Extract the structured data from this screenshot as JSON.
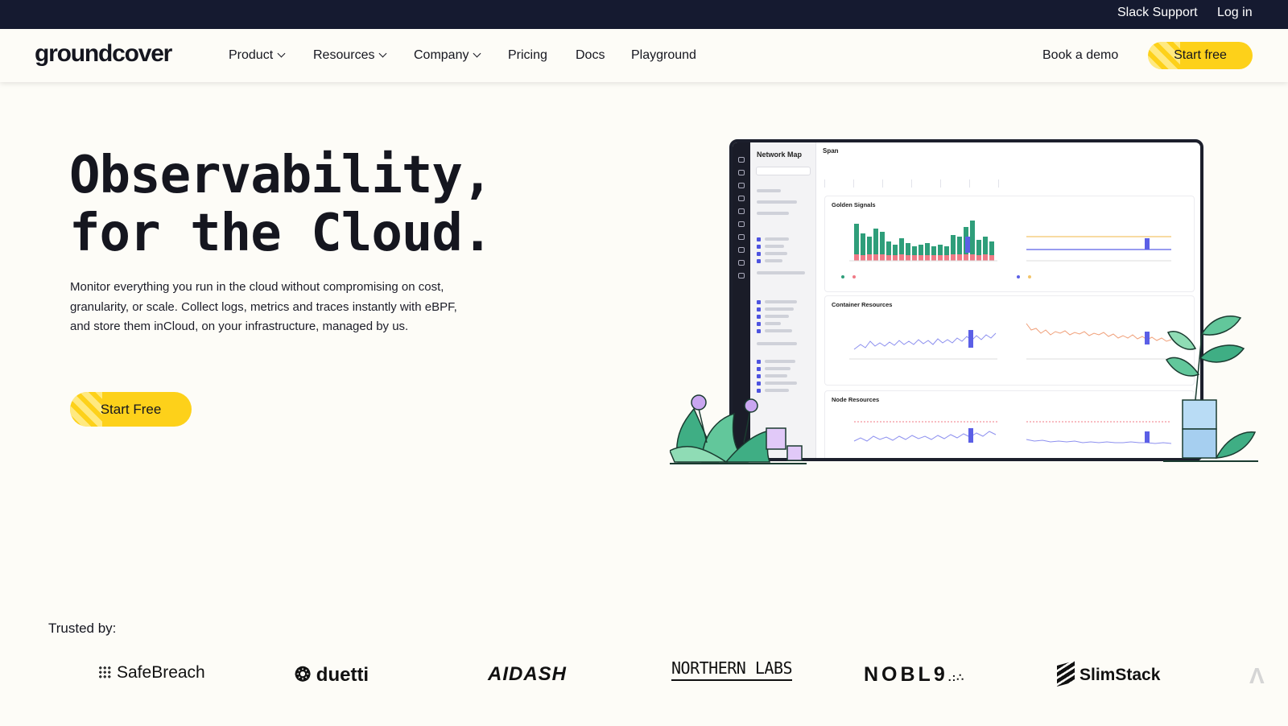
{
  "topbar": {
    "slack_support": "Slack Support",
    "log_in": "Log in"
  },
  "brand": {
    "logo_text": "groundcover"
  },
  "nav": {
    "items": [
      {
        "label": "Product",
        "has_dropdown": true
      },
      {
        "label": "Resources",
        "has_dropdown": true
      },
      {
        "label": "Company",
        "has_dropdown": true
      },
      {
        "label": "Pricing",
        "has_dropdown": false
      },
      {
        "label": "Docs",
        "has_dropdown": false
      },
      {
        "label": "Playground",
        "has_dropdown": false
      }
    ],
    "book_demo": "Book a demo",
    "start_free": "Start free"
  },
  "hero": {
    "title_line1": "Observability,",
    "title_line2": "for the Cloud.",
    "description": "Monitor everything you run in the cloud without compromising on cost, granularity, or scale. Collect logs, metrics and traces instantly with eBPF, and store them inCloud, on your infrastructure, managed by us.",
    "cta": "Start Free"
  },
  "dashboard": {
    "sidebar_title": "Network Map",
    "span_label": "Span",
    "card1_title": "Golden Signals",
    "card2_title": "Container Resources",
    "card3_title": "Node Resources"
  },
  "trusted": {
    "label": "Trusted by:",
    "logos": [
      "SafeBreach",
      "duetti",
      "AIDASH",
      "NORTHERN LABS",
      "NOBL9",
      "SlimStack"
    ]
  },
  "colors": {
    "topbar_bg": "#151a30",
    "page_bg": "#fdfcf7",
    "accent_yellow": "#fdd11a",
    "chart_green": "#2f9e7a",
    "chart_red": "#f07a86",
    "chart_purple": "#5b5fe6"
  }
}
